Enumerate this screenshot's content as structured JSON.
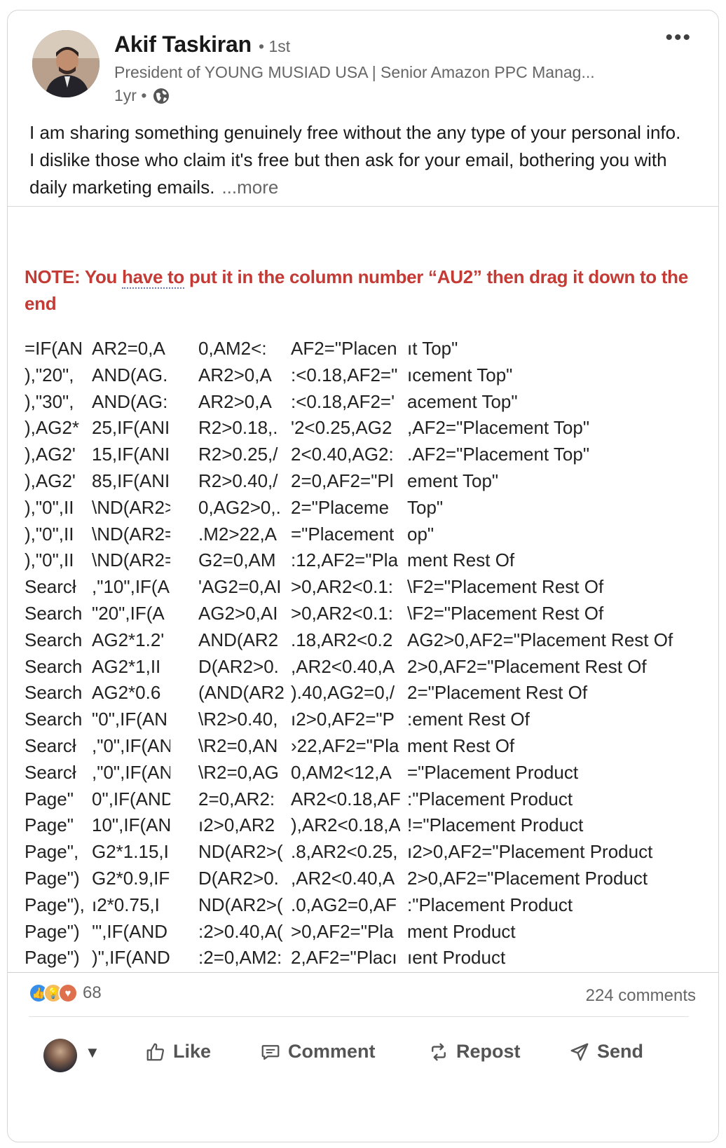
{
  "post": {
    "author": {
      "name": "Akif Taskiran",
      "degree": "• 1st",
      "headline": "President of YOUNG MUSIAD USA | Senior Amazon PPC Manag...",
      "time": "1yr •"
    },
    "text": "I am sharing something genuinely free without the any type of your personal info. I dislike those who claim it's free but then ask for your email, bothering you with daily marketing emails.",
    "see_more": "...more",
    "menu_icon": "ellipsis-icon"
  },
  "media": {
    "note_pre": "NOTE: You ",
    "note_dotted": "have to",
    "note_post": " put it in the column number “AU2” then drag it down to the end",
    "rows": [
      [
        "=IF(AN",
        "AR2=0,A",
        "0,AM2<:",
        "AF2=\"Placen",
        "ıt Top\""
      ],
      [
        "),\"20\",",
        "AND(AG.",
        "AR2>0,A",
        ":<0.18,AF2=\"",
        "ıcement Top\""
      ],
      [
        "),\"30\",",
        "AND(AG:",
        "AR2>0,A",
        ":<0.18,AF2='",
        "acement Top\""
      ],
      [
        "),AG2*",
        "25,IF(ANI",
        "R2>0.18,.",
        "'2<0.25,AG2",
        ",AF2=\"Placement Top\""
      ],
      [
        "),AG2'",
        "15,IF(ANI",
        "R2>0.25,/",
        "2<0.40,AG2:",
        ".AF2=\"Placement Top\""
      ],
      [
        "),AG2'",
        "85,IF(ANI",
        "R2>0.40,/",
        "2=0,AF2=\"Pl",
        "ement Top\""
      ],
      [
        "),\"0\",II",
        "\\ND(AR2>",
        "0,AG2>0,.",
        "2=\"Placeme",
        "Top\""
      ],
      [
        "),\"0\",II",
        "\\ND(AR2=",
        ".M2>22,A",
        "=\"Placement",
        "op\""
      ],
      [
        "),\"0\",II",
        "\\ND(AR2=",
        "G2=0,AM",
        ":12,AF2=\"Pla",
        "ment Rest Of"
      ],
      [
        "Searcł",
        ",\"10\",IF(A",
        "'AG2=0,AI",
        ">0,AR2<0.1:",
        "\\F2=\"Placement Rest Of"
      ],
      [
        "Search",
        "\"20\",IF(A",
        "AG2>0,AI",
        ">0,AR2<0.1:",
        "\\F2=\"Placement Rest Of"
      ],
      [
        "Search",
        "AG2*1.2'",
        "AND(AR2",
        ".18,AR2<0.2",
        "AG2>0,AF2=\"Placement Rest Of"
      ],
      [
        "Search",
        "AG2*1,II",
        "D(AR2>0.",
        ",AR2<0.40,A",
        "2>0,AF2=\"Placement Rest Of"
      ],
      [
        "Search",
        "AG2*0.6",
        "(AND(AR2",
        ").40,AG2=0,/",
        "2=\"Placement Rest Of"
      ],
      [
        "Search",
        "\"0\",IF(AN",
        "\\R2>0.40,",
        "ı2>0,AF2=\"P",
        ":ement Rest Of"
      ],
      [
        "Searcł",
        ",\"0\",IF(AN",
        "\\R2=0,AN",
        "›22,AF2=\"Pla",
        "ment Rest Of"
      ],
      [
        "Searcł",
        ",\"0\",IF(AN",
        "\\R2=0,AG",
        "0,AM2<12,A",
        "=\"Placement Product"
      ],
      [
        "Page\"",
        "0\",IF(AND",
        "2=0,AR2:",
        "AR2<0.18,AF",
        ":\"Placement Product"
      ],
      [
        "Page\"",
        "10\",IF(ANI",
        "ı2>0,AR2",
        "),AR2<0.18,A",
        "!=\"Placement Product"
      ],
      [
        "Page\",",
        "G2*1.15,I",
        "ND(AR2>(",
        ".8,AR2<0.25,",
        "ı2>0,AF2=\"Placement Product"
      ],
      [
        "Page\")",
        "G2*0.9,IF(",
        "D(AR2>0.",
        ",AR2<0.40,A",
        "2>0,AF2=\"Placement Product"
      ],
      [
        "Page\"),",
        "ı2*0.75,I",
        "ND(AR2>(",
        ".0,AG2=0,AF",
        ":\"Placement Product"
      ],
      [
        "Page\")",
        "'\",IF(AND",
        ":2>0.40,A(",
        ">0,AF2=\"Pla",
        "ment Product"
      ],
      [
        "Page\")",
        ")\",IF(AND",
        ":2=0,AM2:",
        "2,AF2=\"Placı",
        "ıent Product"
      ]
    ]
  },
  "social": {
    "reaction_count": "68",
    "comments": "224 comments"
  },
  "actions": {
    "like": "Like",
    "comment": "Comment",
    "repost": "Repost",
    "send": "Send"
  }
}
